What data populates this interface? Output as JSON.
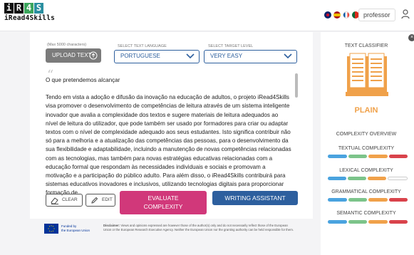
{
  "logo": {
    "letters": [
      "i",
      "R",
      "4",
      "S"
    ],
    "subtitle": "iRead4Skills"
  },
  "header": {
    "username": "professor",
    "user_icon": "user-icon",
    "languages": [
      "en",
      "es",
      "fr",
      "pt"
    ]
  },
  "form": {
    "max_chars_label": "(Max 5000 characters)",
    "upload_label": "UPLOAD TEXT",
    "text_language_label": "SELECT TEXT LANGUAGE",
    "text_language_value": "PORTUGUESE",
    "target_level_label": "SELECT TARGET LEVEL",
    "target_level_value": "VERY EASY"
  },
  "text": {
    "title": "O que pretendemos alcançar",
    "body": "Tendo em vista a adoção e difusão da inovação na educação de adultos, o projeto iRead4Skills visa promover o desenvolvimento de competências de leitura através de um sistema inteligente inovador que avalia a complexidade dos textos e sugere materiais de leitura adequados ao nível de leitura do utilizador, que pode também ser usado por formadores para criar ou adaptar textos com o nível de complexidade adequado aos seus estudantes. Isto significa contribuir não só para a melhoria e a atualização das competências das pessoas, para o desenvolvimento da sua flexibilidade e adaptabilidade, incluindo a manutenção de novas competências relacionadas com as tecnologias, mas também para novas estratégias educativas relacionadas com a educação formal que respondam às necessidades individuais e sociais e promovam a motivação e a participação do público adulto. Para além disso, o iRead4Skills contribuirá para sistemas educativos inovadores e inclusivos, utilizando tecnologias digitais para proporcionar formação de"
  },
  "actions": {
    "clear_label": "CLEAR",
    "edit_label": "EDIT",
    "evaluate_line1": "EVALUATE",
    "evaluate_line2": "COMPLEXITY",
    "writing_label": "WRITING ASSISTANT"
  },
  "footer": {
    "funded_line1": "Funded by",
    "funded_line2": "the European Union",
    "disclaimer_bold": "Disclaimer:",
    "disclaimer": "Views and opinions expressed are however those of the author(s) only and do not necessarily reflect those of the European Union or the European Research Executive Agency. Neither the European Union nor the granting authority can be held responsible for them."
  },
  "classifier": {
    "title": "TEXT CLASSIFIER",
    "result": "PLAIN",
    "overview_title": "COMPLEXITY OVERVIEW",
    "metrics": [
      {
        "label": "TEXTUAL COMPLEXITY",
        "colors": [
          "#4aa3df",
          "#7cc48a",
          "#f0a14a",
          "#d9434b"
        ]
      },
      {
        "label": "LEXICAL COMPLEXITY",
        "colors": [
          "#4aa3df",
          "#7cc48a",
          "#f0a14a",
          "#ffffff"
        ]
      },
      {
        "label": "GRAMMATICAL COMPLEXITY",
        "colors": [
          "#4aa3df",
          "#7cc48a",
          "#f0a14a",
          "#d9434b"
        ]
      },
      {
        "label": "SEMANTIC COMPLEXITY",
        "colors": [
          "#4aa3df",
          "#7cc48a",
          "#f0a14a",
          "#d9434b"
        ]
      }
    ]
  },
  "colors": {
    "accent_blue": "#2d5f9e",
    "evaluate_pink": "#d1387a",
    "plain_orange": "#f0a14a"
  }
}
